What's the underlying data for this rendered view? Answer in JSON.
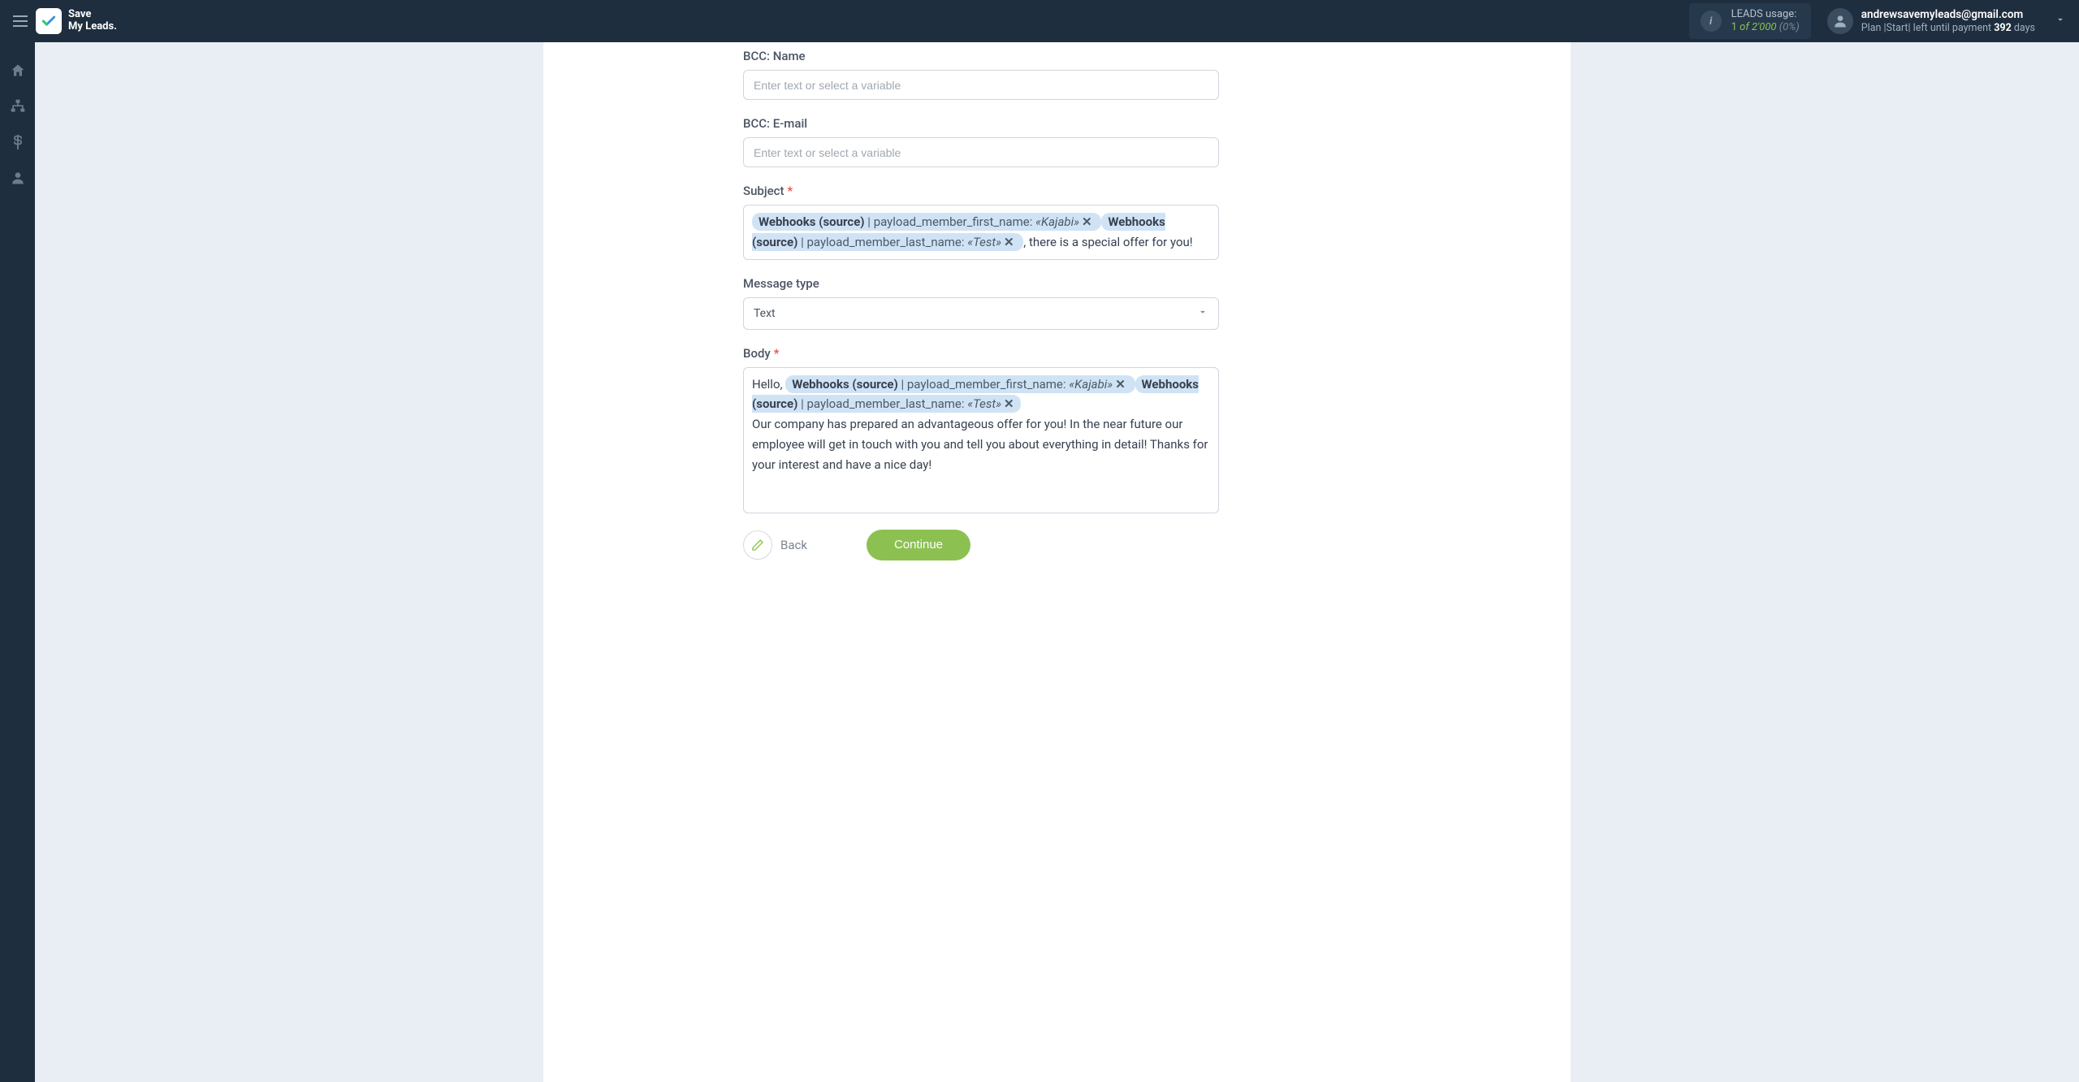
{
  "topbar": {
    "logo_line1": "Save",
    "logo_line2": "My Leads.",
    "usage_label": "LEADS usage:",
    "usage_current": "1",
    "usage_of_word": "of",
    "usage_limit": "2'000",
    "usage_pct": "(0%)",
    "user_email": "andrewsavemyleads@gmail.com",
    "plan_prefix": "Plan |Start| left until payment ",
    "plan_days_num": "392",
    "plan_days_word": " days"
  },
  "form": {
    "bcc_name_label": "BCC: Name",
    "bcc_name_placeholder": "Enter text or select a variable",
    "bcc_email_label": "BCC: E-mail",
    "bcc_email_placeholder": "Enter text or select a variable",
    "subject_label": "Subject",
    "subject_trailing": ", there is a special offer for you!",
    "message_type_label": "Message type",
    "message_type_value": "Text",
    "body_label": "Body",
    "body_hello": "Hello, ",
    "body_paragraph": "Our company has prepared an advantageous offer for you! In the near future our employee will get in touch with you and tell you about everything in detail! Thanks for your interest and have a nice day!",
    "tags": {
      "subj1_source": "Webhooks (source)",
      "subj1_sep": " | ",
      "subj1_field": "payload_member_first_name: ",
      "subj1_val": "«Kajabi»",
      "subj2_source": "Webhooks (source)",
      "subj2_sep": " | ",
      "subj2_field": "payload_member_last_name: ",
      "subj2_val": "«Test»",
      "body1_source": "Webhooks (source)",
      "body1_sep": " | ",
      "body1_field": "payload_member_first_name: ",
      "body1_val": "«Kajabi»",
      "body2_source": "Webhooks (source)",
      "body2_sep": " | ",
      "body2_field": "payload_member_last_name: ",
      "body2_val": "«Test»"
    }
  },
  "buttons": {
    "back": "Back",
    "continue": "Continue"
  }
}
